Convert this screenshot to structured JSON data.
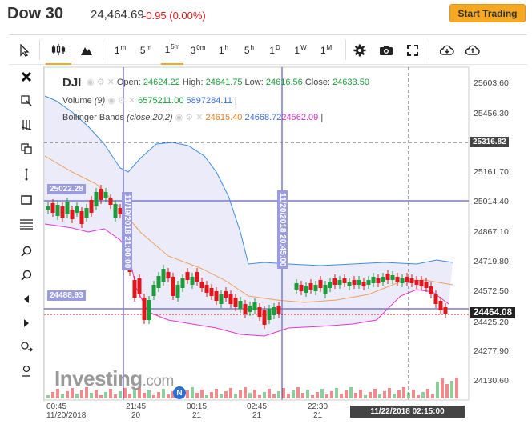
{
  "header": {
    "symbol": "Dow 30",
    "price": "24,464.69",
    "change": "-0.95 (0.00%)",
    "start_trading": "Start Trading"
  },
  "toolbar": {
    "intervals": [
      "1m",
      "5m",
      "15m",
      "30m",
      "1h",
      "5h",
      "1D",
      "1W",
      "1M"
    ],
    "active_interval": "15m"
  },
  "legend": {
    "symbol": "DJI",
    "ohlc": {
      "open_label": "Open:",
      "open": "24624.22",
      "high_label": "High:",
      "high": "24641.75",
      "low_label": "Low:",
      "low": "24616.56",
      "close_label": "Close:",
      "close": "24633.50"
    },
    "volume": {
      "label": "Volume",
      "param": "(9)",
      "v1": "6575211.00",
      "v2": "5897284.11",
      "bar": "|"
    },
    "bollinger": {
      "label": "Bollinger Bands",
      "params": "(close,20,2)",
      "mid": "24615.40",
      "upper": "24668.72",
      "lower": "24562.09",
      "bar": "|"
    }
  },
  "y_axis": [
    "25603.60",
    "25456.30",
    "25161.70",
    "25014.40",
    "24867.10",
    "24719.80",
    "24572.50",
    "24425.20",
    "24277.90",
    "24130.60"
  ],
  "price_tags": {
    "crosshair": "25316.82",
    "last": "24464.08",
    "left_top": "25022.28",
    "left_bottom": "24488.93"
  },
  "vertical_labels": {
    "left": "11/19/2018 21:00:00",
    "right": "11/20/2018 20:45:00"
  },
  "x_axis": [
    {
      "time": "00:45",
      "date": "11/20/2018"
    },
    {
      "time": "21:45",
      "date": "20"
    },
    {
      "time": "00:15",
      "date": "21"
    },
    {
      "time": "02:45",
      "date": "21"
    },
    {
      "time": "22:30",
      "date": "21"
    }
  ],
  "x_crosshair": "11/22/2018 02:15:00",
  "watermark": {
    "brand": "Investing",
    "suffix": ".com"
  },
  "colors": {
    "up": "#1b9e3a",
    "down": "#e0161b",
    "upper_band": "#3a8ee6",
    "lower_band": "#e633d0",
    "mid_band": "#f0a060",
    "band_fill": "#e9e7f8",
    "accent": "#f6a821"
  }
}
